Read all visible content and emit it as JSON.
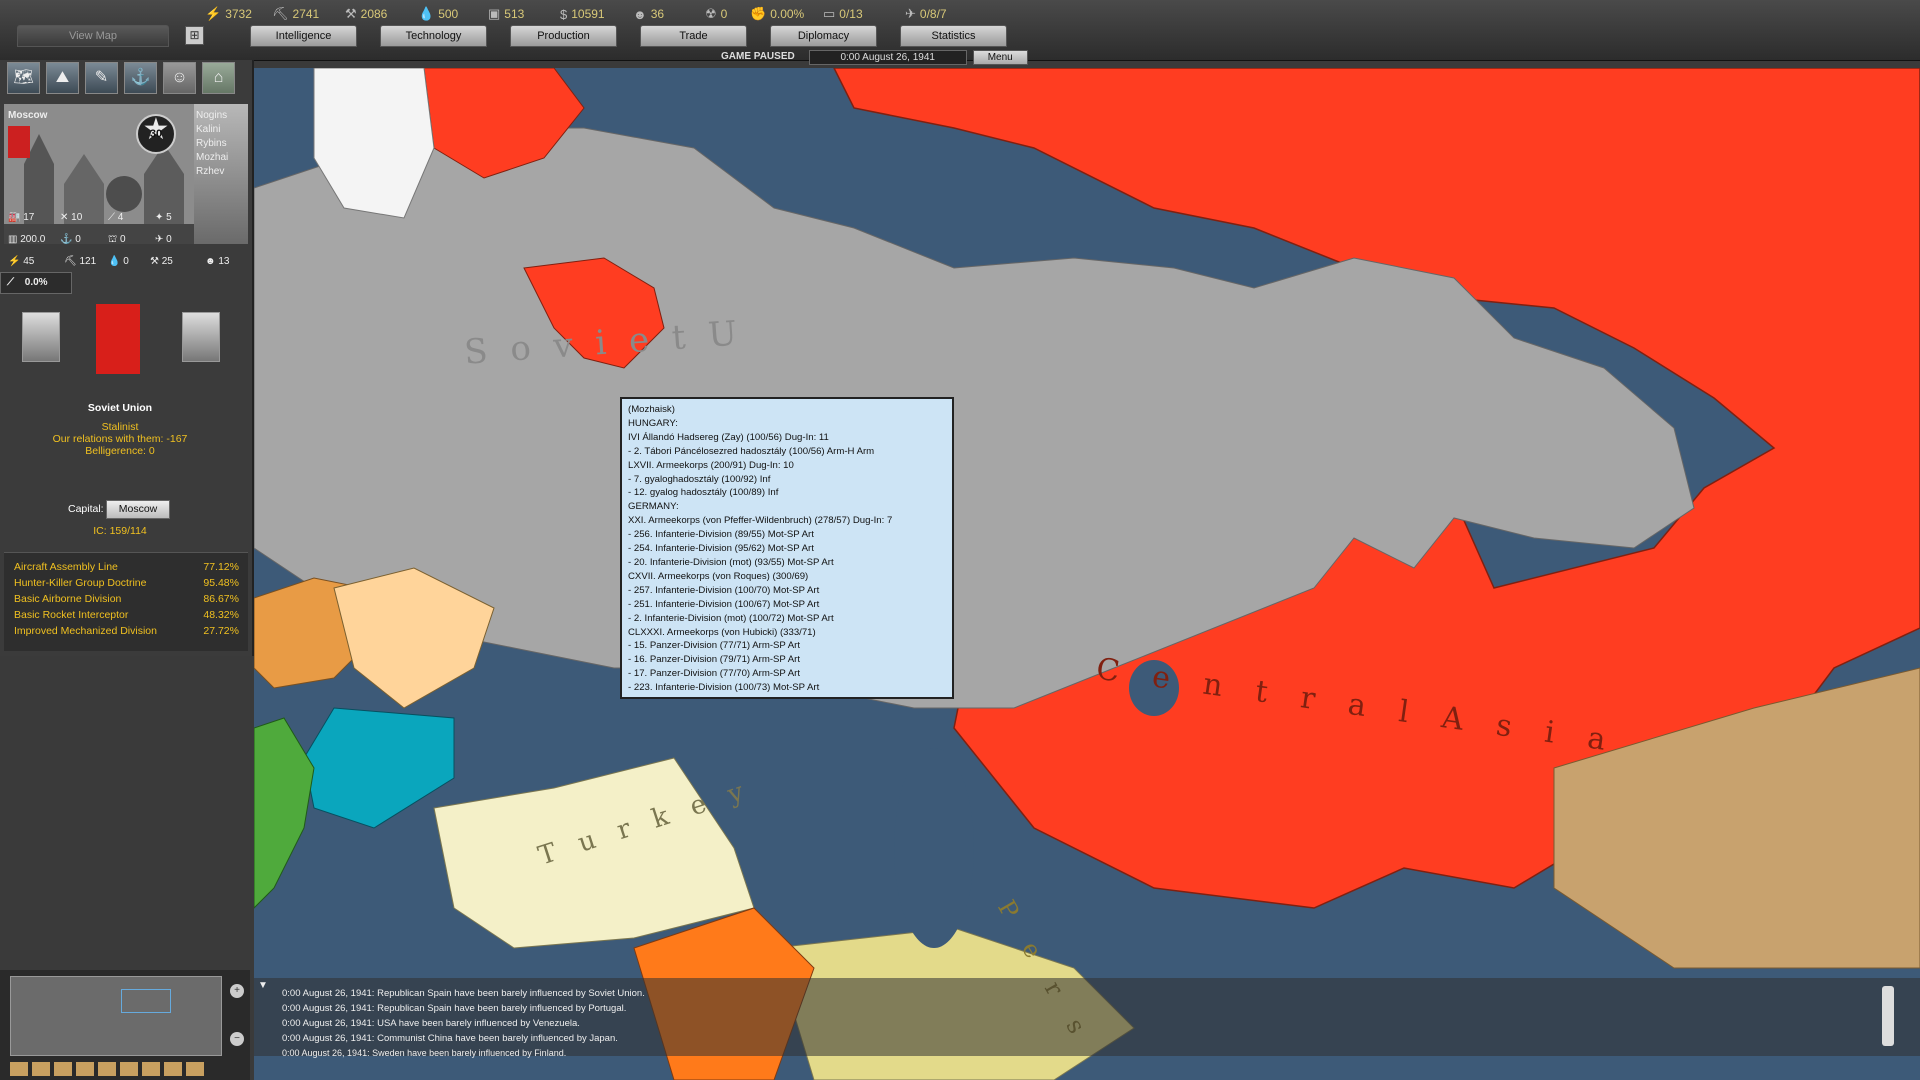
{
  "resources": {
    "energy": "3732",
    "metal": "2741",
    "rare": "2086",
    "oil": "500",
    "supplies": "513",
    "money": "10591",
    "manpower": "36",
    "nukes": "0",
    "dissent": "0.00%",
    "transports": "0/13",
    "escorts": "0/8/7"
  },
  "tabs": {
    "view_map": "View Map",
    "intelligence": "Intelligence",
    "technology": "Technology",
    "production": "Production",
    "trade": "Trade",
    "diplomacy": "Diplomacy",
    "statistics": "Statistics"
  },
  "status": {
    "paused": "GAME PAUSED",
    "date": "0:00 August 26, 1941",
    "menu": "Menu"
  },
  "province": {
    "name": "Moscow",
    "vp": "30",
    "neighbors": [
      "Nogins",
      "Kalini",
      "Rybins",
      "Mozhai",
      "Rzhev"
    ],
    "row1": [
      "17",
      "10",
      "4",
      "5"
    ],
    "row2": [
      "200.0",
      "0",
      "0",
      "0"
    ],
    "row3": [
      "45",
      "121",
      "0",
      "25",
      "13"
    ],
    "supply": "0.0%"
  },
  "country": {
    "name": "Soviet Union",
    "ideology": "Stalinist",
    "relations": "Our relations with them: -167",
    "belligerence": "Belligerence: 0",
    "capital_label": "Capital:",
    "capital": "Moscow",
    "ic": "IC: 159/114"
  },
  "research": [
    {
      "name": "Aircraft Assembly Line",
      "value": "77.12%"
    },
    {
      "name": "Hunter-Killer Group Doctrine",
      "value": "95.48%"
    },
    {
      "name": "Basic Airborne Division",
      "value": "86.67%"
    },
    {
      "name": "Basic Rocket Interceptor",
      "value": "48.32%"
    },
    {
      "name": "Improved Mechanized Division",
      "value": "27.72%"
    }
  ],
  "map_labels": {
    "soviet": "S o v i e t   U",
    "central_asia": "C e n t r a l   A s i a",
    "turkey": "T u r k e y",
    "persia": "P e r s"
  },
  "tooltip": [
    "(Mozhaisk)",
    "HUNGARY:",
    "IVI Állandó Hadsereg (Zay)     (100/56) Dug-In: 11",
    " - 2. Tábori Páncélosezred hadosztály (100/56) Arm-H Arm",
    "LXVII. Armeekorps     (200/91) Dug-In: 10",
    " - 7. gyaloghadosztály (100/92) Inf",
    " - 12. gyalog hadosztály (100/89) Inf",
    "GERMANY:",
    "XXI. Armeekorps (von Pfeffer-Wildenbruch)     (278/57) Dug-In: 7",
    " - 256. Infanterie-Division (89/55) Mot-SP Art",
    " - 254. Infanterie-Division (95/62) Mot-SP Art",
    " - 20. Infanterie-Division (mot) (93/55) Mot-SP Art",
    "CXVII. Armeekorps (von Roques)     (300/69)",
    " - 257. Infanterie-Division (100/70) Mot-SP Art",
    " - 251. Infanterie-Division (100/67) Mot-SP Art",
    " - 2. Infanterie-Division (mot) (100/72) Mot-SP Art",
    "CLXXXI. Armeekorps (von Hubicki)     (333/71)",
    " - 15. Panzer-Division (77/71) Arm-SP Art",
    " - 16. Panzer-Division (79/71) Arm-SP Art",
    " - 17. Panzer-Division (77/70) Arm-SP Art",
    " - 223. Infanterie-Division (100/73) Mot-SP Art"
  ],
  "log": [
    "0:00 August 26, 1941: Republican Spain have been barely influenced by Soviet Union.",
    "0:00 August 26, 1941: Republican Spain have been barely influenced by Portugal.",
    "0:00 August 26, 1941: USA have been barely influenced by Venezuela.",
    "0:00 August 26, 1941: Communist China have been barely influenced by Japan.",
    "0:00 August 26, 1941: Sweden have been barely influenced by Finland."
  ],
  "colors": {
    "soviet": "#ff3d21",
    "occupied": "#a6a6a6",
    "sea": "#3d5a78",
    "turkey": "#f4f0c8",
    "tooltip_bg": "#cde4f5",
    "research_text": "#f0c020"
  }
}
